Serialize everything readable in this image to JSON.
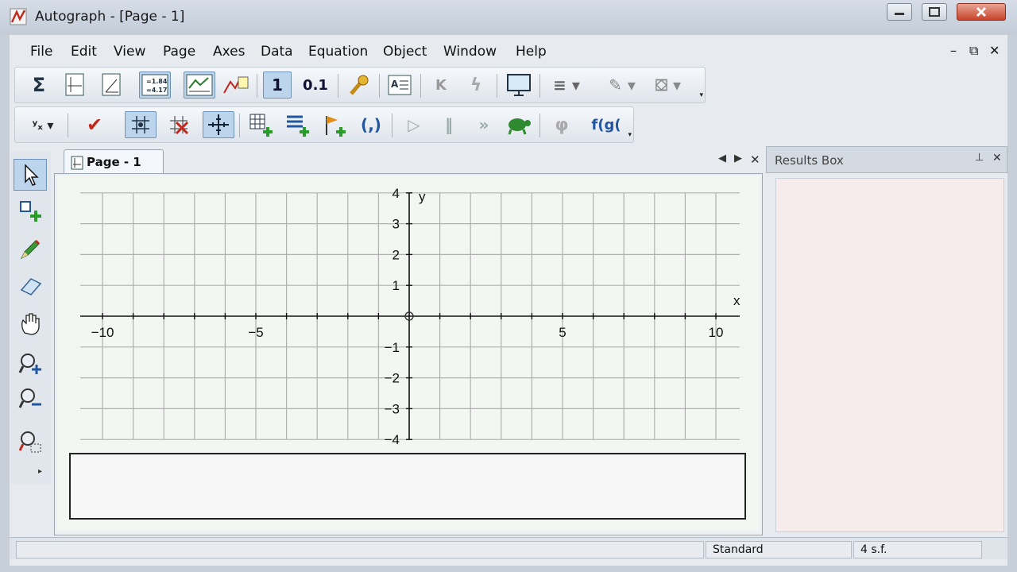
{
  "window": {
    "title": "Autograph - [Page - 1]"
  },
  "menu": [
    "File",
    "Edit",
    "View",
    "Page",
    "Axes",
    "Data",
    "Equation",
    "Object",
    "Window",
    "Help"
  ],
  "mdi_controls": {
    "minimize": "–",
    "restore": "⧉",
    "close": "✕"
  },
  "toolbar1": {
    "buttons": [
      {
        "name": "statistics-icon",
        "glyph": "Σ",
        "pressed": false
      },
      {
        "name": "new-2d-page-icon",
        "glyph": "⊥",
        "pressed": false
      },
      {
        "name": "new-graph-page-icon",
        "glyph": "∠",
        "pressed": false
      },
      {
        "name": "show-results-icon",
        "glyph": "=1.84",
        "pressed": true
      },
      {
        "name": "data-grid-icon",
        "glyph": "≋",
        "pressed": true
      },
      {
        "name": "key-legend-icon",
        "glyph": "⋰",
        "pressed": false
      },
      {
        "name": "one-d-mode-icon",
        "glyph": "1",
        "pressed": true
      },
      {
        "name": "decimal-places-icon",
        "glyph": "0.1",
        "pressed": false
      },
      {
        "name": "settings-icon",
        "glyph": "🔧",
        "pressed": false
      },
      {
        "name": "text-box-icon",
        "glyph": "A≡",
        "pressed": false
      },
      {
        "name": "constant-controller-icon",
        "glyph": "K",
        "pressed": false
      },
      {
        "name": "flash-icon",
        "glyph": "ϟ",
        "pressed": false
      },
      {
        "name": "slideshow-icon",
        "glyph": "▭",
        "pressed": false
      },
      {
        "name": "line-style-icon",
        "glyph": "≡",
        "pressed": false
      },
      {
        "name": "pen-color-icon",
        "glyph": "✎",
        "pressed": false
      },
      {
        "name": "fill-color-icon",
        "glyph": "⛋",
        "pressed": false
      }
    ]
  },
  "toolbar2": {
    "buttons": [
      {
        "name": "axis-label-icon",
        "glyph": "ʸₓ",
        "pressed": false
      },
      {
        "name": "check-icon",
        "glyph": "✔",
        "pressed": false
      },
      {
        "name": "snap-grid-icon",
        "glyph": "⊹",
        "pressed": true
      },
      {
        "name": "delete-point-icon",
        "glyph": "✖",
        "pressed": false
      },
      {
        "name": "axes-grid-icon",
        "glyph": "╬",
        "pressed": true
      },
      {
        "name": "add-table-icon",
        "glyph": "⊞+",
        "pressed": false
      },
      {
        "name": "add-list-icon",
        "glyph": "≡+",
        "pressed": false
      },
      {
        "name": "add-point-icon",
        "glyph": "⚑+",
        "pressed": false
      },
      {
        "name": "coordinates-icon",
        "glyph": "(,)",
        "pressed": false
      },
      {
        "name": "animate-play-icon",
        "glyph": "▷",
        "pressed": false
      },
      {
        "name": "animate-pause-icon",
        "glyph": "‖",
        "pressed": false
      },
      {
        "name": "animate-fast-icon",
        "glyph": "»",
        "pressed": false
      },
      {
        "name": "turtle-icon",
        "glyph": "🐢",
        "pressed": false
      },
      {
        "name": "phi-icon",
        "glyph": "φ",
        "pressed": false
      },
      {
        "name": "composite-function-icon",
        "glyph": "f(g(",
        "pressed": false
      }
    ]
  },
  "left_tools": [
    {
      "name": "select-icon",
      "glyph": "⬉",
      "pressed": true
    },
    {
      "name": "add-object-icon",
      "glyph": "⧉+",
      "pressed": false
    },
    {
      "name": "pencil-icon",
      "glyph": "✎",
      "pressed": false
    },
    {
      "name": "eraser-icon",
      "glyph": "▱",
      "pressed": false
    },
    {
      "name": "hand-icon",
      "glyph": "✋",
      "pressed": false
    },
    {
      "name": "zoom-in-icon",
      "glyph": "⊕",
      "pressed": false
    },
    {
      "name": "zoom-out-icon",
      "glyph": "⊖",
      "pressed": false
    },
    {
      "name": "zoom-box-icon",
      "glyph": "⊡",
      "pressed": false
    }
  ],
  "document": {
    "tab_label": "Page - 1",
    "nav_prev": "◀",
    "nav_next": "▶",
    "close": "✕"
  },
  "graph": {
    "x_axis_label": "x",
    "y_axis_label": "y",
    "x_range": [
      -10,
      10
    ],
    "y_range": [
      -4,
      4
    ],
    "grid": true,
    "x_tick_labels": [
      "−10",
      "−5",
      "5",
      "10"
    ],
    "y_tick_labels": [
      "4",
      "3",
      "2",
      "1",
      "−1",
      "−2",
      "−3",
      "−4"
    ]
  },
  "results_panel": {
    "title": "Results Box",
    "pin": "⊥",
    "close": "✕"
  },
  "status_bar": {
    "message": "",
    "mode": "Standard",
    "sig_figs": "4 s.f."
  },
  "colors": {
    "grid_background": "#f3f7f2",
    "grid_line": "#b0b0b0",
    "axis": "#111111",
    "results_background": "#f6ecec"
  }
}
